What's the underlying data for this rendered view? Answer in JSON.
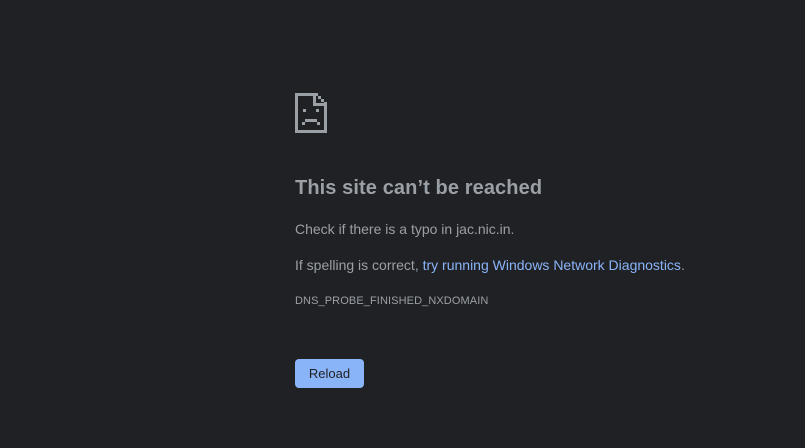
{
  "error": {
    "icon": "sad-document-icon",
    "title": "This site can’t be reached",
    "check_text": "Check if there is a typo in jac.nic.in.",
    "spelling_prefix": "If spelling is correct, ",
    "diagnostics_link": "try running Windows Network Diagnostics",
    "spelling_suffix": ".",
    "error_code": "DNS_PROBE_FINISHED_NXDOMAIN",
    "reload_label": "Reload"
  },
  "colors": {
    "background": "#202124",
    "text": "#9aa0a6",
    "link": "#8ab4f8",
    "button": "#8ab4f8"
  }
}
